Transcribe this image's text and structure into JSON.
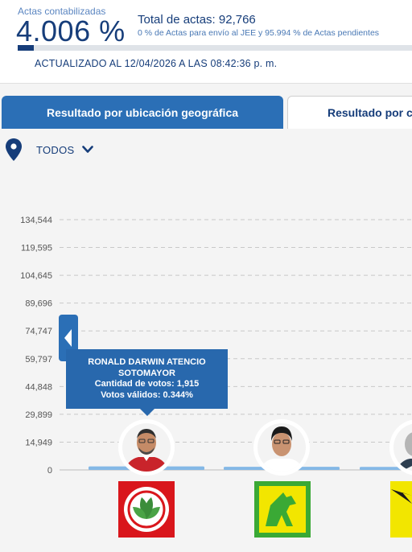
{
  "summary": {
    "label": "Actas contabilizadas",
    "percent": "4.006 %",
    "progress_fraction": 0.04006,
    "total": "Total de actas: 92,766",
    "note": "0 % de Actas para envío al JEE y 95.994 % de Actas pendientes",
    "updated": "ACTUALIZADO AL 12/04/2026 A LAS 08:42:36 p. m."
  },
  "tabs": [
    {
      "label": "Resultado por ubicación geográfica",
      "active": true
    },
    {
      "label": "Resultado por candidato",
      "active": false
    }
  ],
  "filter": {
    "label": "TODOS",
    "icon": "location-pin-icon",
    "chevron": "chevron-down-icon"
  },
  "colors": {
    "accent": "#2b6fb6",
    "dark_blue": "#163d7a",
    "bar": "#84b8e6",
    "tooltip": "#2868ad"
  },
  "chart_data": {
    "type": "bar",
    "ylim": [
      0,
      134544
    ],
    "yticks": [
      "134,544",
      "119,595",
      "104,645",
      "89,696",
      "74,747",
      "59,797",
      "44,848",
      "29,899",
      "14,949",
      "0"
    ],
    "values": [
      1915,
      1700,
      1600
    ],
    "tooltip": {
      "name_line1": "RONALD DARWIN ATENCIO",
      "name_line2": "SOTOMAYOR",
      "votes": "Cantidad de votos: 1,915",
      "valid": "Votos válidos: 0.344%"
    }
  }
}
